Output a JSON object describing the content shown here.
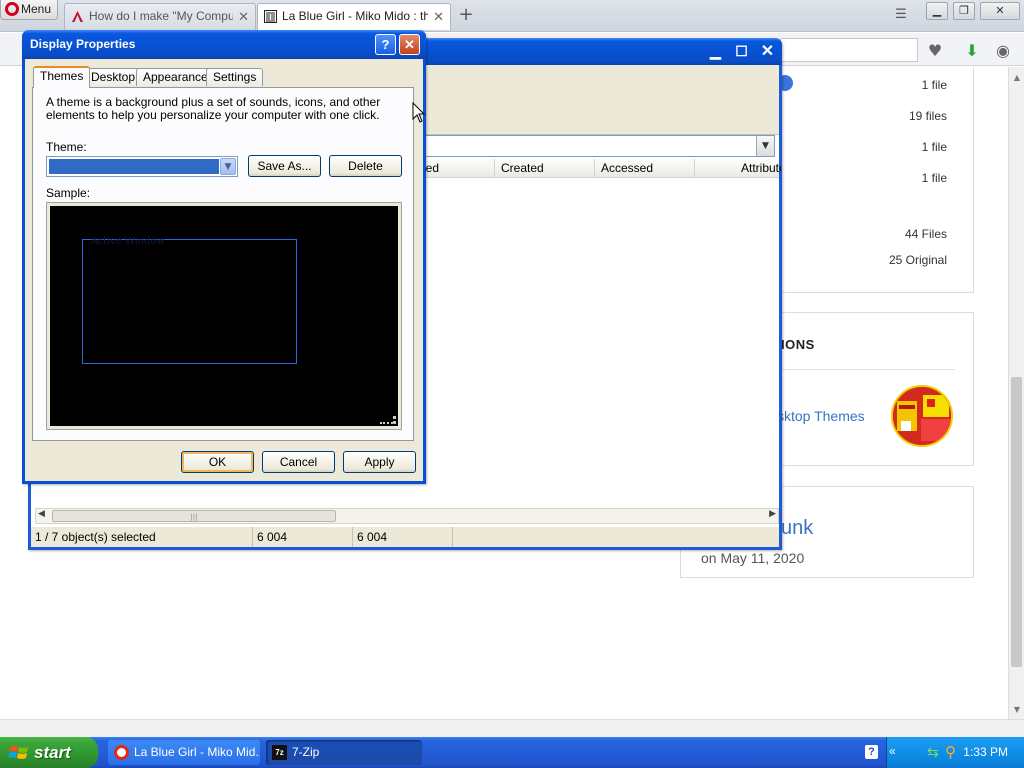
{
  "browser": {
    "menu_label": "Menu",
    "tabs": [
      {
        "label": "How do I make \"My Compute",
        "active": false
      },
      {
        "label": "La Blue Girl - Miko Mido : ther",
        "active": true
      }
    ],
    "new_tab": "+",
    "window_controls": {
      "minimize": "▁",
      "restore": "❐",
      "close": "✕"
    }
  },
  "webpage": {
    "stats": [
      {
        "value": "1 file"
      },
      {
        "value": "19 files"
      },
      {
        "value": "1 file"
      },
      {
        "value": "1 file"
      },
      {
        "value": "44 Files"
      },
      {
        "value": "25 Original"
      }
    ],
    "related_heading": "IONS",
    "related_link": "sktop Themes",
    "author_name": "unk",
    "author_date": "on May 11, 2020"
  },
  "zip_window": {
    "title": "",
    "columns": [
      "ied",
      "Created",
      "Accessed",
      "Attribute"
    ],
    "status": {
      "selected": "1 / 7 object(s) selected",
      "size": "6 004",
      "packed": "6 004"
    }
  },
  "dialog": {
    "title": "Display Properties",
    "help_button": "?",
    "close_button": "✕",
    "tabs": [
      "Themes",
      "Desktop",
      "Appearance",
      "Settings"
    ],
    "description": "A theme is a background plus a set of sounds, icons, and other elements to help you personalize your computer with one click.",
    "theme_label": "Theme:",
    "theme_value": "",
    "save_as": "Save As...",
    "delete": "Delete",
    "sample_label": "Sample:",
    "sample_window_title": "Active Window",
    "ok": "OK",
    "cancel": "Cancel",
    "apply": "Apply"
  },
  "taskbar": {
    "start": "start",
    "tasks": [
      {
        "label": "La Blue Girl - Miko Mid..."
      },
      {
        "label": "7-Zip"
      }
    ],
    "clock": "1:33 PM"
  },
  "colors": {
    "xp_blue": "#0a57dd",
    "start_green": "#3aa43a",
    "link_blue": "#3b73c4",
    "selection": "#316ac5"
  }
}
